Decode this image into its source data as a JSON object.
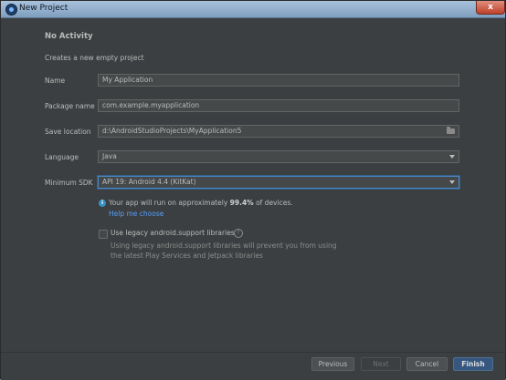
{
  "window": {
    "title": "New Project",
    "close_symbol": "x"
  },
  "header": {
    "title": "No Activity",
    "description": "Creates a new empty project"
  },
  "form": {
    "name": {
      "label": "Name",
      "value": "My Application"
    },
    "package": {
      "label": "Package name",
      "value": "com.example.myapplication"
    },
    "save_location": {
      "label": "Save location",
      "value": "d:\\AndroidStudioProjects\\MyApplication5"
    },
    "language": {
      "label": "Language",
      "value": "Java"
    },
    "min_sdk": {
      "label": "Minimum SDK",
      "value": "API 19: Android 4.4 (KitKat)"
    }
  },
  "info": {
    "text_before": "Your app will run on approximately ",
    "percent": "99.4%",
    "text_after": " of devices.",
    "help_link": "Help me choose",
    "icon_glyph": "i"
  },
  "legacy": {
    "label": "Use legacy android.support libraries",
    "hint_line1": "Using legacy android.support libraries will prevent you from using",
    "hint_line2": "the latest Play Services and Jetpack libraries",
    "help_glyph": "?"
  },
  "footer": {
    "previous": "Previous",
    "next": "Next",
    "cancel": "Cancel",
    "finish": "Finish"
  },
  "colors": {
    "background": "#3c3f41",
    "accent": "#365880",
    "link": "#589df6",
    "titlebar": "#a9c2dc"
  }
}
